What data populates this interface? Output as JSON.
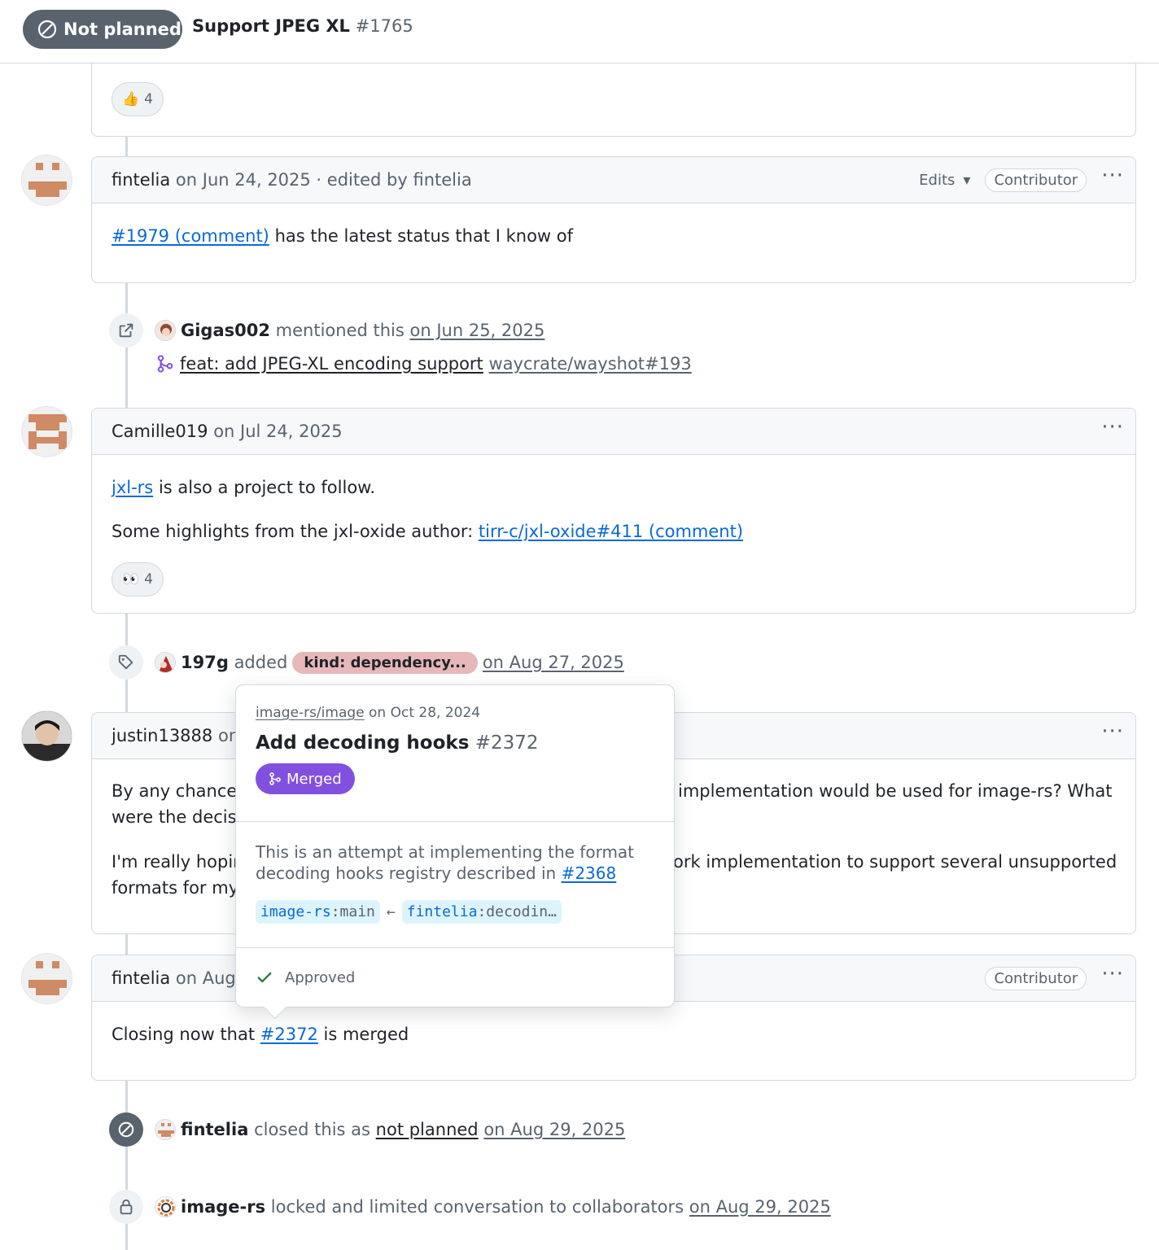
{
  "header": {
    "state": "Not planned",
    "title": "Support JPEG XL",
    "number": "#1765"
  },
  "top_comment": {
    "reaction_emoji": "👍",
    "reaction_count": "4"
  },
  "comment1": {
    "author": "fintelia",
    "meta": "on Jun 24, 2025 · edited by fintelia",
    "edits": "Edits",
    "role": "Contributor",
    "link": "#1979 (comment)",
    "text": "has the latest status that I know of"
  },
  "mention": {
    "user": "Gigas002",
    "action": "mentioned this",
    "date": "on Jun 25, 2025",
    "pr_title": "feat: add JPEG-XL encoding support",
    "pr_ref": "waycrate/wayshot#193"
  },
  "comment2": {
    "author": "Camille019",
    "meta": "on Jul 24, 2025",
    "link1": "jxl-rs",
    "text1": "is also a project to follow.",
    "text2": "Some highlights from the jxl-oxide author:",
    "link2": "tirr-c/jxl-oxide#411 (comment)",
    "reaction_emoji": "👀",
    "reaction_count": "4"
  },
  "label_event": {
    "user": "197g",
    "action": "added",
    "label": "kind: dependency...",
    "date": "on Aug 27, 2025"
  },
  "comment3": {
    "author": "justin13888",
    "meta_partial": "on A",
    "line1a": "By any chance,",
    "line1b": "implementation would be used for image-rs? What",
    "line2a": "were the decisio",
    "line3a": "I'm really hopin",
    "line3b": "ork implementation to support several unsupported",
    "line4a": "formats for my"
  },
  "comment4": {
    "author": "fintelia",
    "meta_partial": "on Aug 2",
    "role": "Contributor",
    "text1": "Closing now that",
    "link": "#2372",
    "text2": "is merged"
  },
  "close_event": {
    "user": "fintelia",
    "action": "closed this as",
    "reason": "not planned",
    "date": "on Aug 29, 2025"
  },
  "lock_event": {
    "user": "image-rs",
    "action": "locked and limited conversation to collaborators",
    "date": "on Aug 29, 2025"
  },
  "hovercard": {
    "repo": "image-rs/image",
    "repo_date": "on Oct 28, 2024",
    "title": "Add decoding hooks",
    "number": "#2372",
    "status": "Merged",
    "desc1": "This is an attempt at implementing the format",
    "desc2": "decoding hooks registry described in",
    "desc_link": "#2368",
    "base_owner": "image-rs",
    "base_branch": ":main",
    "arrow": "←",
    "head_owner": "fintelia",
    "head_branch": ":decodin…",
    "review": "Approved"
  },
  "colors": {
    "accent": "#0969da",
    "merged": "#8250df",
    "closed_gray": "#59636e",
    "label": "#e6b8b9"
  }
}
